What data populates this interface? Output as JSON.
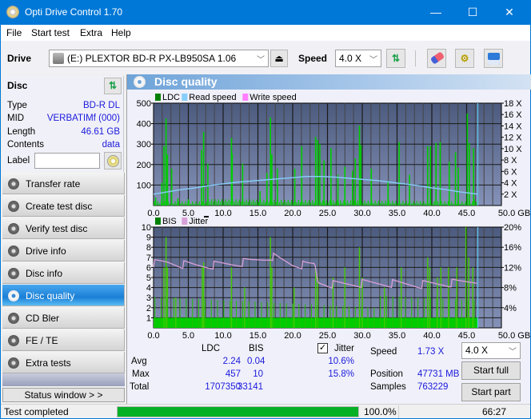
{
  "window": {
    "title": "Opti Drive Control 1.70",
    "minimize": "—",
    "maximize": "☐",
    "close": "✕"
  },
  "menu": [
    "File",
    "Start test",
    "Extra",
    "Help"
  ],
  "toolbar": {
    "drive_label": "Drive",
    "drive_value": "(E:)  PLEXTOR BD-R  PX-LB950SA 1.06",
    "speed_label": "Speed",
    "speed_value": "4.0 X"
  },
  "disc": {
    "header": "Disc",
    "fields": [
      {
        "key": "Type",
        "value": "BD-R DL"
      },
      {
        "key": "MID",
        "value": "VERBATIMf (000)"
      },
      {
        "key": "Length",
        "value": "46.61 GB"
      },
      {
        "key": "Contents",
        "value": "data"
      }
    ],
    "label_key": "Label",
    "label_value": ""
  },
  "nav": [
    {
      "label": "Transfer rate",
      "active": false
    },
    {
      "label": "Create test disc",
      "active": false
    },
    {
      "label": "Verify test disc",
      "active": false
    },
    {
      "label": "Drive info",
      "active": false
    },
    {
      "label": "Disc info",
      "active": false
    },
    {
      "label": "Disc quality",
      "active": true
    },
    {
      "label": "CD Bler",
      "active": false
    },
    {
      "label": "FE / TE",
      "active": false
    },
    {
      "label": "Extra tests",
      "active": false
    }
  ],
  "status_window_label": "Status window > >",
  "panel_title": "Disc quality",
  "colors": {
    "ldc": "#008000",
    "read_speed": "#87cefa",
    "write_speed": "#ff80ff",
    "bis": "#008000",
    "jitter": "#d8a0d8",
    "bar_green": "#00cc00",
    "plot_bg_top": "#4b5a7d",
    "plot_bg_bottom": "#8592b8",
    "progress": "#06b025"
  },
  "chart_data": [
    {
      "type": "bar",
      "title": "LDC",
      "legend": [
        "LDC",
        "Read speed",
        "Write speed"
      ],
      "legend_position": "top-left",
      "xlabel": "GB",
      "x_ticks": [
        "0.0",
        "5.0",
        "10.0",
        "15.0",
        "20.0",
        "25.0",
        "30.0",
        "35.0",
        "40.0",
        "45.0",
        "50.0 GB"
      ],
      "xlim": [
        0,
        50
      ],
      "y_ticks_left": [
        "100",
        "200",
        "300",
        "400",
        "500"
      ],
      "ylim_left": [
        0,
        500
      ],
      "y_ticks_right": [
        "2 X",
        "4 X",
        "6 X",
        "8 X",
        "10 X",
        "12 X",
        "14 X",
        "16 X",
        "18 X"
      ],
      "ylim_right": [
        0,
        18
      ],
      "grid": true,
      "end_marker_gb": 46.61,
      "ldc_spikes": [
        [
          0.3,
          40
        ],
        [
          1.2,
          110
        ],
        [
          1.5,
          290
        ],
        [
          1.8,
          425
        ],
        [
          2.0,
          250
        ],
        [
          2.6,
          180
        ],
        [
          3.5,
          35
        ],
        [
          5.0,
          30
        ],
        [
          6.9,
          270
        ],
        [
          7.2,
          360
        ],
        [
          7.8,
          205
        ],
        [
          11.2,
          330
        ],
        [
          11.3,
          255
        ],
        [
          12.8,
          205
        ],
        [
          15.3,
          70
        ],
        [
          16.3,
          160
        ],
        [
          16.8,
          430
        ],
        [
          17.0,
          250
        ],
        [
          17.8,
          180
        ],
        [
          20.3,
          180
        ],
        [
          21.3,
          290
        ],
        [
          23.3,
          335
        ],
        [
          23.6,
          320
        ],
        [
          23.9,
          300
        ],
        [
          24.5,
          220
        ],
        [
          25.5,
          280
        ],
        [
          26.5,
          150
        ],
        [
          27.5,
          190
        ],
        [
          28.6,
          170
        ],
        [
          29.0,
          230
        ],
        [
          29.6,
          390
        ],
        [
          29.8,
          295
        ],
        [
          31.3,
          180
        ],
        [
          33.7,
          120
        ],
        [
          35.3,
          310
        ],
        [
          36.8,
          150
        ],
        [
          39.4,
          290
        ],
        [
          39.8,
          290
        ],
        [
          40.6,
          305
        ],
        [
          41.2,
          310
        ],
        [
          42.5,
          215
        ],
        [
          43.4,
          260
        ],
        [
          43.8,
          185
        ],
        [
          45.1,
          450
        ],
        [
          45.4,
          305
        ],
        [
          46.0,
          280
        ]
      ],
      "read_speed_x": [
        [
          0,
          2.0
        ],
        [
          2,
          2.4
        ],
        [
          4,
          2.8
        ],
        [
          6,
          3.1
        ],
        [
          8,
          3.5
        ],
        [
          10,
          3.8
        ],
        [
          12,
          4.1
        ],
        [
          14,
          4.3
        ],
        [
          16,
          4.5
        ],
        [
          18,
          4.7
        ],
        [
          20,
          4.9
        ],
        [
          22,
          5.1
        ],
        [
          24,
          5.1
        ],
        [
          26,
          5.0
        ],
        [
          28,
          4.8
        ],
        [
          30,
          4.6
        ],
        [
          32,
          4.4
        ],
        [
          34,
          4.1
        ],
        [
          36,
          3.8
        ],
        [
          38,
          3.5
        ],
        [
          40,
          3.1
        ],
        [
          42,
          2.8
        ],
        [
          44,
          2.4
        ],
        [
          46.6,
          2.0
        ]
      ]
    },
    {
      "type": "bar",
      "title": "BIS",
      "legend": [
        "BIS",
        "Jitter"
      ],
      "legend_position": "top-left",
      "xlabel": "GB",
      "x_ticks": [
        "0.0",
        "5.0",
        "10.0",
        "15.0",
        "20.0",
        "25.0",
        "30.0",
        "35.0",
        "40.0",
        "45.0",
        "50.0 GB"
      ],
      "xlim": [
        0,
        50
      ],
      "y_ticks_left": [
        "1",
        "2",
        "3",
        "4",
        "5",
        "6",
        "7",
        "8",
        "9",
        "10"
      ],
      "ylim_left": [
        0,
        10
      ],
      "y_ticks_right": [
        "4%",
        "8%",
        "12%",
        "16%",
        "20%"
      ],
      "ylim_right": [
        0,
        20
      ],
      "grid": true,
      "end_marker_gb": 46.61,
      "bis_spikes": [
        [
          1.5,
          6
        ],
        [
          1.8,
          9
        ],
        [
          2.0,
          6
        ],
        [
          3.2,
          3
        ],
        [
          7.0,
          6
        ],
        [
          7.2,
          6.5
        ],
        [
          11.2,
          6
        ],
        [
          13.1,
          4
        ],
        [
          16.8,
          9
        ],
        [
          17.0,
          6
        ],
        [
          20.2,
          4
        ],
        [
          23.3,
          6
        ],
        [
          23.6,
          5
        ],
        [
          25.8,
          5
        ],
        [
          27.5,
          6
        ],
        [
          29.6,
          8
        ],
        [
          30.0,
          5
        ],
        [
          33.2,
          4
        ],
        [
          35.6,
          6
        ],
        [
          39.4,
          7
        ],
        [
          39.7,
          6
        ],
        [
          40.8,
          5
        ],
        [
          41.3,
          6
        ],
        [
          42.4,
          6
        ],
        [
          43.6,
          6
        ],
        [
          44.9,
          10
        ],
        [
          45.3,
          7
        ],
        [
          45.9,
          6
        ]
      ],
      "jitter_pct": [
        [
          0,
          12.8
        ],
        [
          2,
          13.0
        ],
        [
          4,
          12.6
        ],
        [
          6,
          12.4
        ],
        [
          8,
          12.4
        ],
        [
          10,
          12.6
        ],
        [
          12,
          12.8
        ],
        [
          14,
          13.2
        ],
        [
          16,
          13.8
        ],
        [
          17,
          14.2
        ],
        [
          18,
          13.6
        ],
        [
          20,
          12.6
        ],
        [
          22,
          12.4
        ],
        [
          23.2,
          12.6
        ],
        [
          23.6,
          9.0
        ],
        [
          26,
          8.6
        ],
        [
          30,
          8.8
        ],
        [
          34,
          8.8
        ],
        [
          38,
          8.6
        ],
        [
          42,
          8.8
        ],
        [
          44,
          9.0
        ],
        [
          46.5,
          9.4
        ]
      ]
    }
  ],
  "stats": {
    "col_ldc": "LDC",
    "col_bis": "BIS",
    "jitter_label": "Jitter",
    "jitter_checked": true,
    "rows": [
      {
        "label": "Avg",
        "ldc": "2.24",
        "bis": "0.04",
        "jitter": "10.6%"
      },
      {
        "label": "Max",
        "ldc": "457",
        "bis": "10",
        "jitter": "15.8%"
      },
      {
        "label": "Total",
        "ldc": "1707350",
        "bis": "33141",
        "jitter": ""
      }
    ],
    "speed_label": "Speed",
    "speed_value": "1.73 X",
    "position_label": "Position",
    "position_value": "47731 MB",
    "samples_label": "Samples",
    "samples_value": "763229",
    "speed_select": "4.0 X",
    "start_full": "Start full",
    "start_part": "Start part"
  },
  "status": {
    "text": "Test completed",
    "progress_pct": 100.0,
    "progress_label": "100.0%",
    "elapsed": "66:27"
  }
}
